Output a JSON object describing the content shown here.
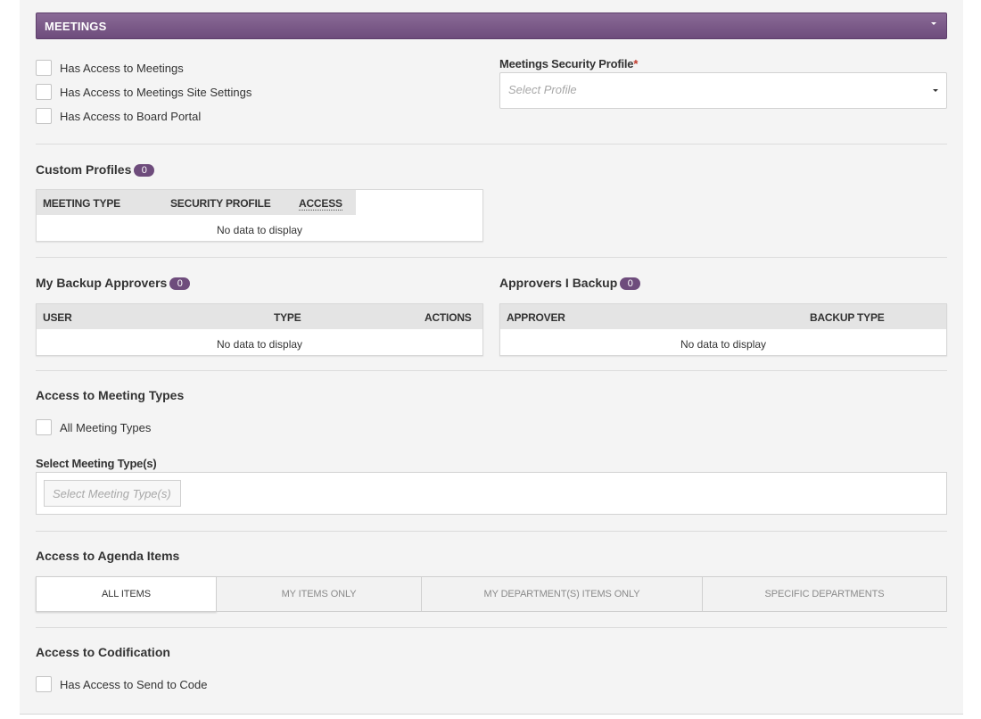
{
  "header": {
    "title": "MEETINGS"
  },
  "access_checkboxes": [
    {
      "label": "Has Access to Meetings",
      "checked": false
    },
    {
      "label": "Has Access to Meetings Site Settings",
      "checked": false
    },
    {
      "label": "Has Access to Board Portal",
      "checked": false
    }
  ],
  "security_profile": {
    "label": "Meetings Security Profile",
    "required_mark": "*",
    "placeholder": "Select Profile"
  },
  "custom_profiles": {
    "title": "Custom Profiles",
    "count": "0",
    "columns": [
      "MEETING TYPE",
      "SECURITY PROFILE",
      "ACCESS"
    ],
    "empty_text": "No data to display"
  },
  "backup_approvers": {
    "title": "My Backup Approvers",
    "count": "0",
    "columns": [
      "USER",
      "TYPE",
      "ACTIONS"
    ],
    "empty_text": "No data to display"
  },
  "approvers_i_backup": {
    "title": "Approvers I Backup",
    "count": "0",
    "columns": [
      "APPROVER",
      "BACKUP TYPE"
    ],
    "empty_text": "No data to display"
  },
  "meeting_types": {
    "title": "Access to Meeting Types",
    "all_label": "All Meeting Types",
    "select_label": "Select Meeting Type(s)",
    "placeholder": "Select Meeting Type(s)"
  },
  "agenda_items": {
    "title": "Access to Agenda Items",
    "options": [
      "ALL ITEMS",
      "MY ITEMS ONLY",
      "MY DEPARTMENT(S) ITEMS ONLY",
      "SPECIFIC DEPARTMENTS"
    ],
    "selected": "ALL ITEMS"
  },
  "codification": {
    "title": "Access to Codification",
    "send_label": "Has Access to Send to Code"
  },
  "colors": {
    "header_purple": "#6e4c7c",
    "badge_purple": "#6e4c7c",
    "required_red": "#c0392b"
  }
}
